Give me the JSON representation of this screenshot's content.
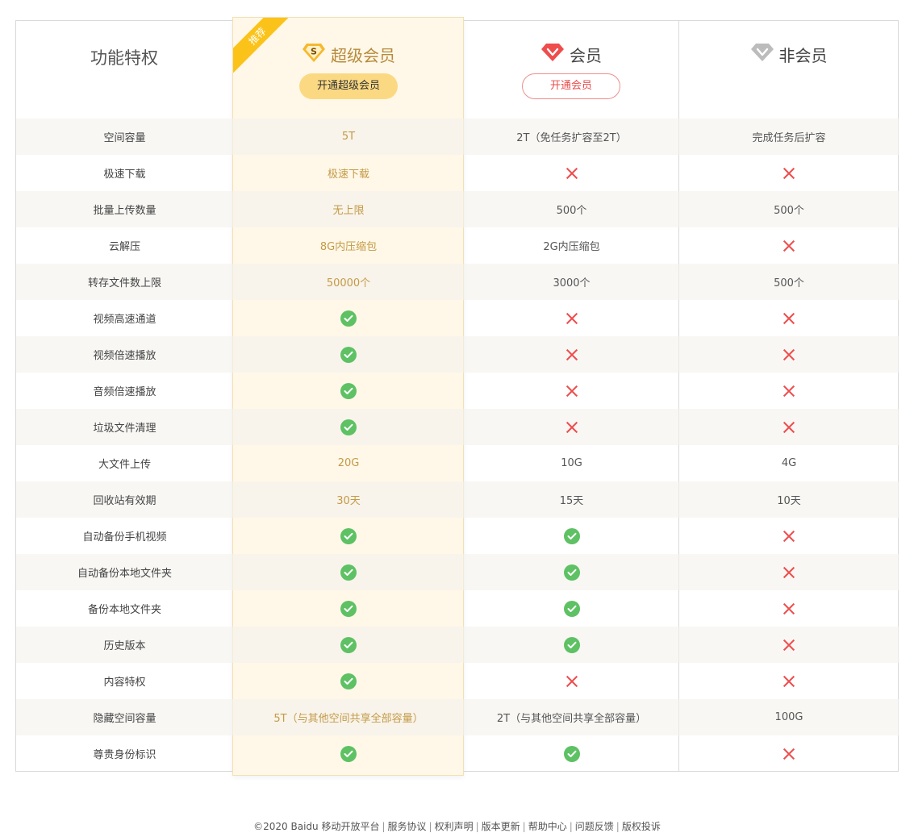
{
  "header": {
    "feature_title": "功能特权",
    "ribbon": "推荐",
    "super": {
      "title": "超级会员",
      "button": "开通超级会员",
      "icon": "super-vip-s-icon"
    },
    "member": {
      "title": "会员",
      "button": "开通会员",
      "icon": "red-diamond-icon"
    },
    "nonmember": {
      "title": "非会员",
      "icon": "gray-diamond-icon"
    }
  },
  "rows": [
    {
      "feature": "空间容量",
      "super": "5T",
      "member": "2T（免任务扩容至2T）",
      "non": "完成任务后扩容"
    },
    {
      "feature": "极速下载",
      "super": "极速下载",
      "member": "cross",
      "non": "cross"
    },
    {
      "feature": "批量上传数量",
      "super": "无上限",
      "member": "500个",
      "non": "500个"
    },
    {
      "feature": "云解压",
      "super": "8G内压缩包",
      "member": "2G内压缩包",
      "non": "cross"
    },
    {
      "feature": "转存文件数上限",
      "super": "50000个",
      "member": "3000个",
      "non": "500个"
    },
    {
      "feature": "视频高速通道",
      "super": "check",
      "member": "cross",
      "non": "cross"
    },
    {
      "feature": "视频倍速播放",
      "super": "check",
      "member": "cross",
      "non": "cross"
    },
    {
      "feature": "音频倍速播放",
      "super": "check",
      "member": "cross",
      "non": "cross"
    },
    {
      "feature": "垃圾文件清理",
      "super": "check",
      "member": "cross",
      "non": "cross"
    },
    {
      "feature": "大文件上传",
      "super": "20G",
      "member": "10G",
      "non": "4G"
    },
    {
      "feature": "回收站有效期",
      "super": "30天",
      "member": "15天",
      "non": "10天"
    },
    {
      "feature": "自动备份手机视频",
      "super": "check",
      "member": "check",
      "non": "cross"
    },
    {
      "feature": "自动备份本地文件夹",
      "super": "check",
      "member": "check",
      "non": "cross"
    },
    {
      "feature": "备份本地文件夹",
      "super": "check",
      "member": "check",
      "non": "cross"
    },
    {
      "feature": "历史版本",
      "super": "check",
      "member": "check",
      "non": "cross"
    },
    {
      "feature": "内容特权",
      "super": "check",
      "member": "cross",
      "non": "cross"
    },
    {
      "feature": "隐藏空间容量",
      "super": "5T（与其他空间共享全部容量）",
      "member": "2T（与其他空间共享全部容量）",
      "non": "100G"
    },
    {
      "feature": "尊贵身份标识",
      "super": "check",
      "member": "check",
      "non": "cross"
    }
  ],
  "footer": {
    "copyright": "©2020 Baidu",
    "links": [
      "移动开放平台",
      "服务协议",
      "权利声明",
      "版本更新",
      "帮助中心",
      "问题反馈",
      "版权投诉"
    ]
  },
  "colors": {
    "accent_gold": "#c49a47",
    "button_gold": "#fbd983",
    "ribbon": "#fbc319",
    "check_green": "#5ec164",
    "cross_red": "#ee4d4d"
  }
}
